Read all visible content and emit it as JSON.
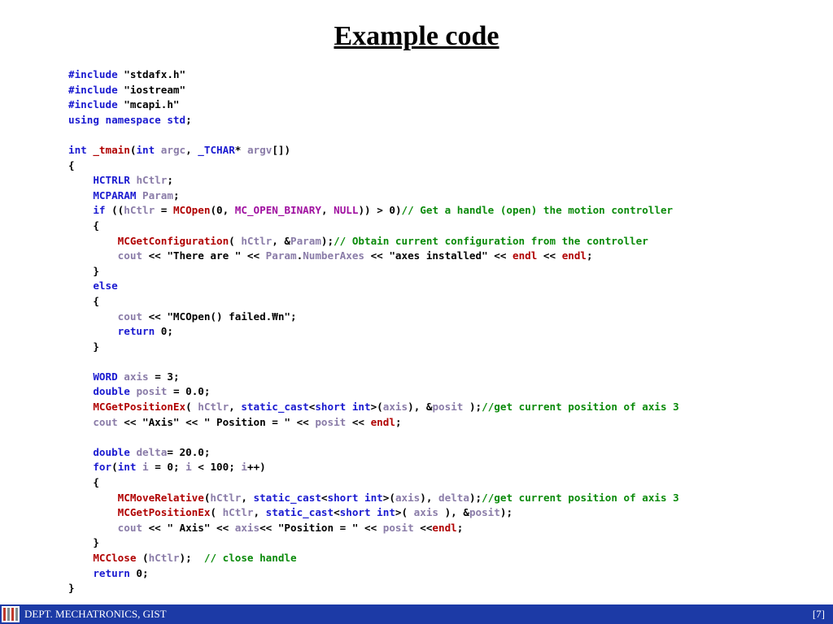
{
  "slide": {
    "title": "Example code"
  },
  "code_lines": [
    [
      [
        "kw",
        "#include"
      ],
      [
        "tx",
        " \"stdafx.h\""
      ]
    ],
    [
      [
        "kw",
        "#include"
      ],
      [
        "tx",
        " \"iostream\""
      ]
    ],
    [
      [
        "kw",
        "#include"
      ],
      [
        "tx",
        " \"mcapi.h\""
      ]
    ],
    [
      [
        "kw",
        "using namespace std"
      ],
      [
        "tx",
        ";"
      ]
    ],
    [],
    [
      [
        "kw",
        "int"
      ],
      [
        "tx",
        " "
      ],
      [
        "fn",
        "_tmain"
      ],
      [
        "tx",
        "("
      ],
      [
        "kw",
        "int"
      ],
      [
        "tx",
        " "
      ],
      [
        "var",
        "argc"
      ],
      [
        "tx",
        ", "
      ],
      [
        "kw",
        "_TCHAR"
      ],
      [
        "tx",
        "* "
      ],
      [
        "var",
        "argv"
      ],
      [
        "tx",
        "[])"
      ]
    ],
    [
      [
        "tx",
        "{"
      ]
    ],
    [
      [
        "tx",
        "    "
      ],
      [
        "kw",
        "HCTRLR"
      ],
      [
        "tx",
        " "
      ],
      [
        "var",
        "hCtlr"
      ],
      [
        "tx",
        ";"
      ]
    ],
    [
      [
        "tx",
        "    "
      ],
      [
        "kw",
        "MCPARAM"
      ],
      [
        "tx",
        " "
      ],
      [
        "var",
        "Param"
      ],
      [
        "tx",
        ";"
      ]
    ],
    [
      [
        "tx",
        "    "
      ],
      [
        "kw",
        "if"
      ],
      [
        "tx",
        " (("
      ],
      [
        "var",
        "hCtlr"
      ],
      [
        "tx",
        " = "
      ],
      [
        "fn",
        "MCOpen"
      ],
      [
        "tx",
        "(0, "
      ],
      [
        "mc",
        "MC_OPEN_BINARY"
      ],
      [
        "tx",
        ", "
      ],
      [
        "mc",
        "NULL"
      ],
      [
        "tx",
        ")) > 0)"
      ],
      [
        "cm",
        "// Get a handle (open) the motion controller"
      ]
    ],
    [
      [
        "tx",
        "    {"
      ]
    ],
    [
      [
        "tx",
        "        "
      ],
      [
        "fn",
        "MCGetConfiguration"
      ],
      [
        "tx",
        "( "
      ],
      [
        "var",
        "hCtlr"
      ],
      [
        "tx",
        ", &"
      ],
      [
        "var",
        "Param"
      ],
      [
        "tx",
        ");"
      ],
      [
        "cm",
        "// Obtain current configuration from the controller"
      ]
    ],
    [
      [
        "tx",
        "        "
      ],
      [
        "var",
        "cout"
      ],
      [
        "tx",
        " << \"There are \" << "
      ],
      [
        "var",
        "Param"
      ],
      [
        "tx",
        "."
      ],
      [
        "var",
        "NumberAxes"
      ],
      [
        "tx",
        " << \"axes installed\" << "
      ],
      [
        "fn",
        "endl"
      ],
      [
        "tx",
        " << "
      ],
      [
        "fn",
        "endl"
      ],
      [
        "tx",
        ";"
      ]
    ],
    [
      [
        "tx",
        "    }"
      ]
    ],
    [
      [
        "tx",
        "    "
      ],
      [
        "kw",
        "else"
      ]
    ],
    [
      [
        "tx",
        "    {"
      ]
    ],
    [
      [
        "tx",
        "        "
      ],
      [
        "var",
        "cout"
      ],
      [
        "tx",
        " << \"MCOpen() failed.₩n\";"
      ]
    ],
    [
      [
        "tx",
        "        "
      ],
      [
        "kw",
        "return"
      ],
      [
        "tx",
        " 0;"
      ]
    ],
    [
      [
        "tx",
        "    }"
      ]
    ],
    [],
    [
      [
        "tx",
        "    "
      ],
      [
        "kw",
        "WORD"
      ],
      [
        "tx",
        " "
      ],
      [
        "var",
        "axis"
      ],
      [
        "tx",
        " = 3;"
      ]
    ],
    [
      [
        "tx",
        "    "
      ],
      [
        "kw",
        "double"
      ],
      [
        "tx",
        " "
      ],
      [
        "var",
        "posit"
      ],
      [
        "tx",
        " = 0.0;"
      ]
    ],
    [
      [
        "tx",
        "    "
      ],
      [
        "fn",
        "MCGetPositionEx"
      ],
      [
        "tx",
        "( "
      ],
      [
        "var",
        "hCtlr"
      ],
      [
        "tx",
        ", "
      ],
      [
        "kw",
        "static_cast"
      ],
      [
        "tx",
        "<"
      ],
      [
        "kw",
        "short int"
      ],
      [
        "tx",
        ">("
      ],
      [
        "var",
        "axis"
      ],
      [
        "tx",
        "), &"
      ],
      [
        "var",
        "posit"
      ],
      [
        "tx",
        " );"
      ],
      [
        "cm",
        "//get current position of axis 3"
      ]
    ],
    [
      [
        "tx",
        "    "
      ],
      [
        "var",
        "cout"
      ],
      [
        "tx",
        " << \"Axis\" << \" Position = \" << "
      ],
      [
        "var",
        "posit"
      ],
      [
        "tx",
        " << "
      ],
      [
        "fn",
        "endl"
      ],
      [
        "tx",
        ";"
      ]
    ],
    [],
    [
      [
        "tx",
        "    "
      ],
      [
        "kw",
        "double"
      ],
      [
        "tx",
        " "
      ],
      [
        "var",
        "delta"
      ],
      [
        "tx",
        "= 20.0;"
      ]
    ],
    [
      [
        "tx",
        "    "
      ],
      [
        "kw",
        "for"
      ],
      [
        "tx",
        "("
      ],
      [
        "kw",
        "int"
      ],
      [
        "tx",
        " "
      ],
      [
        "var",
        "i"
      ],
      [
        "tx",
        " = 0; "
      ],
      [
        "var",
        "i"
      ],
      [
        "tx",
        " < 100; "
      ],
      [
        "var",
        "i"
      ],
      [
        "tx",
        "++)"
      ]
    ],
    [
      [
        "tx",
        "    {"
      ]
    ],
    [
      [
        "tx",
        "        "
      ],
      [
        "fn",
        "MCMoveRelative"
      ],
      [
        "tx",
        "("
      ],
      [
        "var",
        "hCtlr"
      ],
      [
        "tx",
        ", "
      ],
      [
        "kw",
        "static_cast"
      ],
      [
        "tx",
        "<"
      ],
      [
        "kw",
        "short int"
      ],
      [
        "tx",
        ">("
      ],
      [
        "var",
        "axis"
      ],
      [
        "tx",
        "), "
      ],
      [
        "var",
        "delta"
      ],
      [
        "tx",
        ");"
      ],
      [
        "cm",
        "//get current position of axis 3"
      ]
    ],
    [
      [
        "tx",
        "        "
      ],
      [
        "fn",
        "MCGetPositionEx"
      ],
      [
        "tx",
        "( "
      ],
      [
        "var",
        "hCtlr"
      ],
      [
        "tx",
        ", "
      ],
      [
        "kw",
        "static_cast"
      ],
      [
        "tx",
        "<"
      ],
      [
        "kw",
        "short int"
      ],
      [
        "tx",
        ">( "
      ],
      [
        "var",
        "axis"
      ],
      [
        "tx",
        " ), &"
      ],
      [
        "var",
        "posit"
      ],
      [
        "tx",
        ");"
      ]
    ],
    [
      [
        "tx",
        "        "
      ],
      [
        "var",
        "cout"
      ],
      [
        "tx",
        " << \" Axis\" << "
      ],
      [
        "var",
        "axis"
      ],
      [
        "tx",
        "<< \"Position = \" << "
      ],
      [
        "var",
        "posit"
      ],
      [
        "tx",
        " <<"
      ],
      [
        "fn",
        "endl"
      ],
      [
        "tx",
        ";"
      ]
    ],
    [
      [
        "tx",
        "    }"
      ]
    ],
    [
      [
        "tx",
        "    "
      ],
      [
        "fn",
        "MCClose"
      ],
      [
        "tx",
        " ("
      ],
      [
        "var",
        "hCtlr"
      ],
      [
        "tx",
        ");  "
      ],
      [
        "cm",
        "// close handle"
      ]
    ],
    [
      [
        "tx",
        "    "
      ],
      [
        "kw",
        "return"
      ],
      [
        "tx",
        " 0;"
      ]
    ],
    [
      [
        "tx",
        "}"
      ]
    ]
  ],
  "colors": {
    "keyword": "#1a1ad0",
    "function": "#b00000",
    "macro": "#a010a0",
    "variable": "#8a7ca8",
    "comment": "#0a8a0a",
    "footer_bg": "#1c3aa6"
  },
  "footer": {
    "department": "DEPT. MECHATRONICS, GIST",
    "page": "[7]",
    "logo_icon": "gist-logo-icon"
  }
}
